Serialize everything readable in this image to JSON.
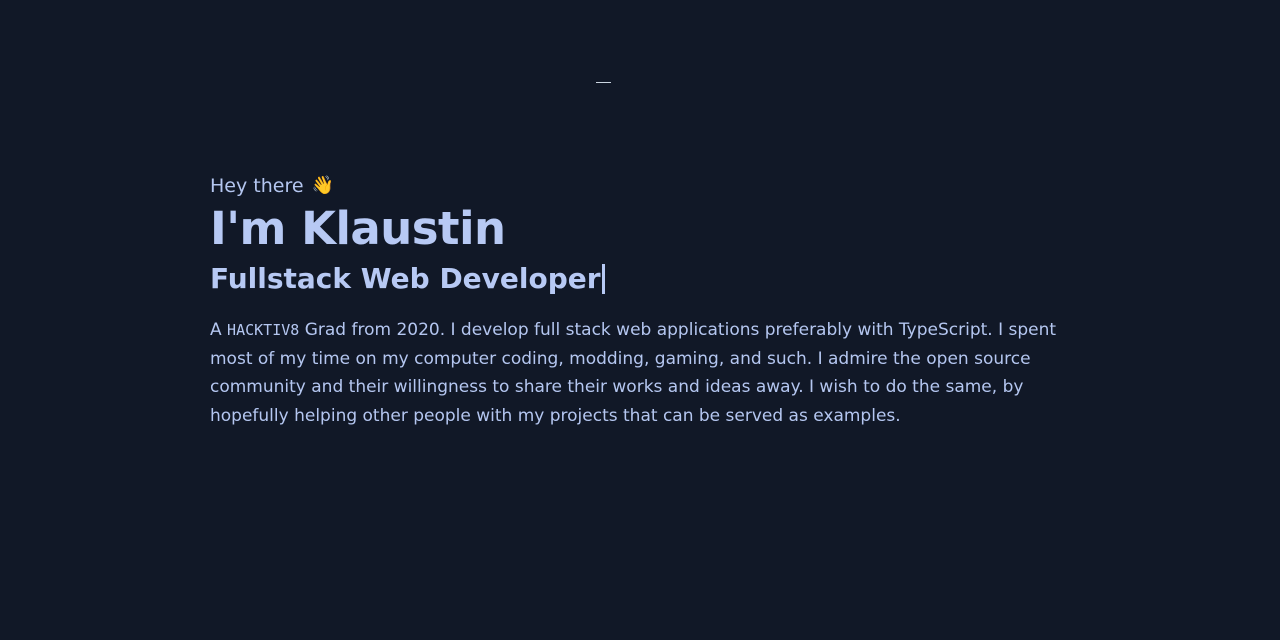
{
  "header": {
    "top_mark": "—"
  },
  "hero": {
    "greeting": "Hey there",
    "greeting_icon": "👋",
    "name": "I'm Klaustin",
    "role": "Fullstack Web Developer",
    "bio": {
      "prefix": "A ",
      "school_code": "HACKTIV8",
      "rest": " Grad from 2020. I develop full stack web applications preferably with TypeScript. I spent most of my time on my computer coding, modding, gaming, and such. I admire the open source community and their willingness to share their works and ideas away. I wish to do the same, by hopefully helping other people with my projects that can be served as examples."
    }
  },
  "theme": {
    "background": "#111827",
    "text": "#b7c9f4"
  }
}
